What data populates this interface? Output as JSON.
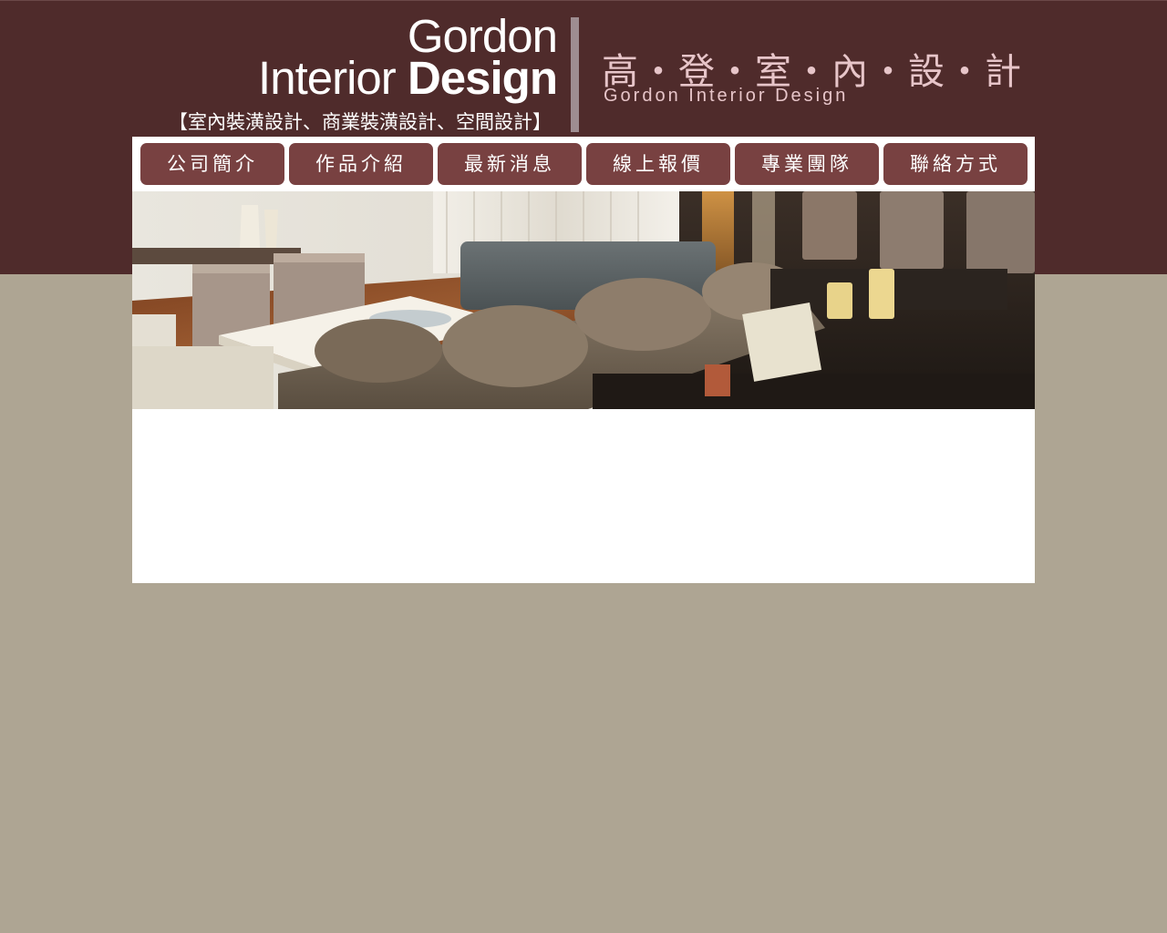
{
  "header": {
    "logo_en_line1": "Gordon",
    "logo_en_line2_regular": "Interior ",
    "logo_en_line2_bold": "Design",
    "tagline": "【室內裝潢設計、商業裝潢設計、空間設計】",
    "logo_cn": "高・登・室・內・設・計",
    "logo_cn_sub": "Gordon Interior Design"
  },
  "nav": {
    "items": [
      {
        "label": "公司簡介"
      },
      {
        "label": "作品介紹"
      },
      {
        "label": "最新消息"
      },
      {
        "label": "線上報價"
      },
      {
        "label": "專業團隊"
      },
      {
        "label": "聯絡方式"
      }
    ]
  },
  "colors": {
    "top_band": "#4f2b2b",
    "page_background": "#aea593",
    "nav_button": "#784141",
    "logo_cn": "#e7c5c9"
  }
}
